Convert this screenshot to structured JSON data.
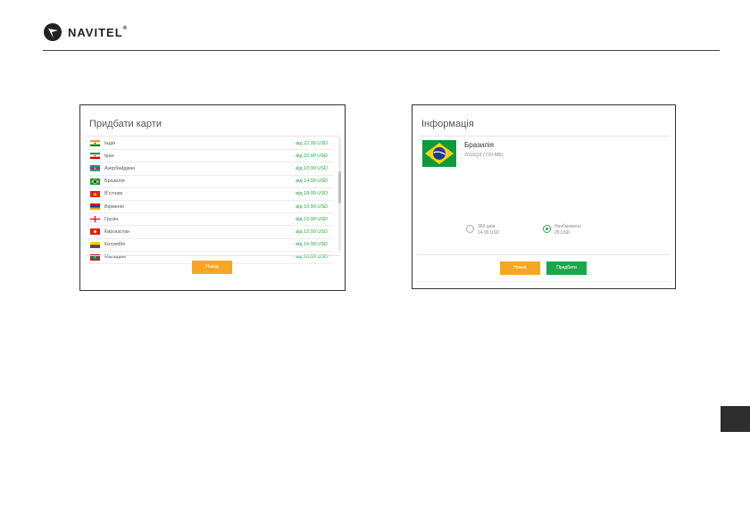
{
  "header": {
    "brand": "NAVITEL",
    "trademark": "®"
  },
  "buy_maps": {
    "title": "Придбати карти",
    "rows": [
      {
        "name": "Індія",
        "price": "від 22.99 USD",
        "flag": "india"
      },
      {
        "name": "Іран",
        "price": "від 22.99 USD",
        "flag": "iran"
      },
      {
        "name": "Азербайджан",
        "price": "від 10.99 USD",
        "flag": "azerbaijan"
      },
      {
        "name": "Бразилія",
        "price": "від 14.99 USD",
        "flag": "brazil"
      },
      {
        "name": "В’єтнам",
        "price": "від 18.99 USD",
        "flag": "vietnam"
      },
      {
        "name": "Вірменія",
        "price": "від 10.99 USD",
        "flag": "armenia"
      },
      {
        "name": "Грузія",
        "price": "від 10.99 USD",
        "flag": "georgia"
      },
      {
        "name": "Киргизстан",
        "price": "від 12.99 USD",
        "flag": "kyrgyzstan"
      },
      {
        "name": "Колумбія",
        "price": "від 16.99 USD",
        "flag": "colombia"
      },
      {
        "name": "Мальдіви",
        "price": "від 10.99 USD",
        "flag": "maldives"
      }
    ],
    "button_label": "Назад"
  },
  "info": {
    "title": "Інформація",
    "country": "Бразилія",
    "details": "2016Q3 (720 МБ)",
    "options": [
      {
        "line1": "365 днів",
        "line2": "14.99 USD",
        "selected": false
      },
      {
        "line1": "Необмежено",
        "line2": "29 USD",
        "selected": true
      }
    ],
    "back_label": "Назад",
    "buy_label": "Придбати"
  },
  "colors": {
    "accent_orange": "#f6a623",
    "accent_green": "#1aa84a",
    "price_green": "#2aa745"
  }
}
